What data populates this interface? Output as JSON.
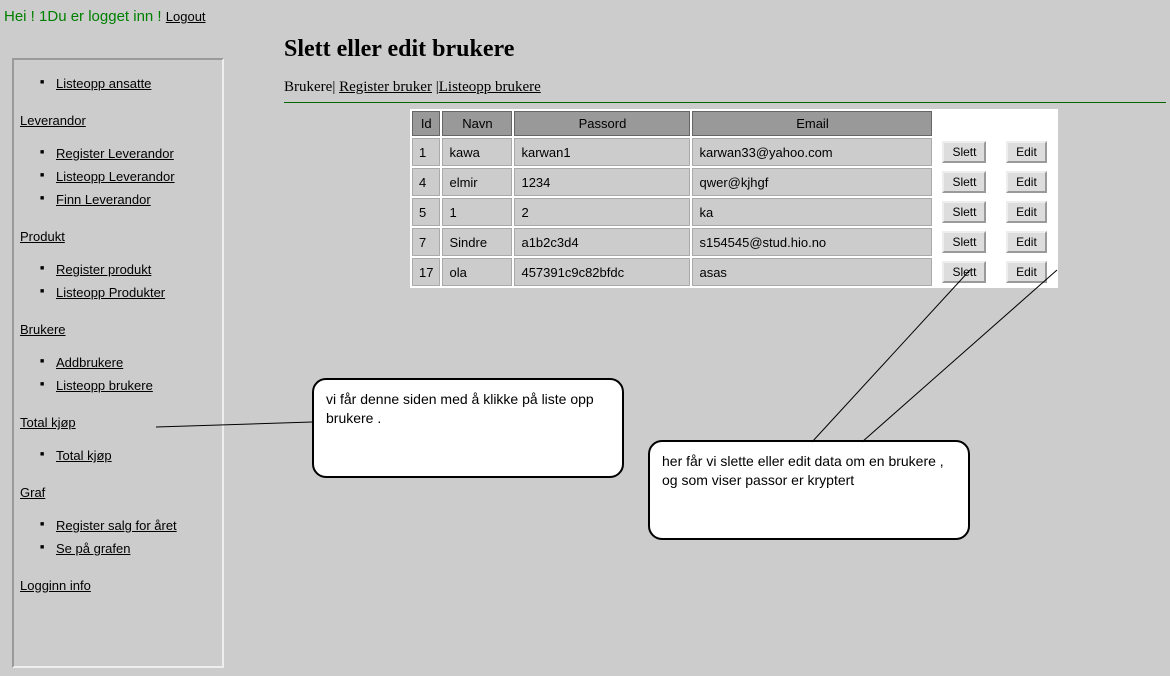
{
  "greeting": {
    "hi": "Hei ! 1",
    "logged_in": "Du er logget inn !",
    "logout": "Logout"
  },
  "sidebar": {
    "first_item": "Listeopp ansatte",
    "groups": [
      {
        "title": "Leverandor",
        "items": [
          "Register Leverandor",
          "Listeopp Leverandor",
          "Finn Leverandor"
        ]
      },
      {
        "title": "Produkt",
        "items": [
          "Register produkt",
          "Listeopp Produkter"
        ]
      },
      {
        "title": "Brukere",
        "items": [
          "Addbrukere",
          "Listeopp brukere"
        ]
      },
      {
        "title": "Total kjøp",
        "items": [
          "Total kjøp"
        ]
      },
      {
        "title": "Graf",
        "items": [
          "Register salg for året",
          "Se på grafen"
        ]
      },
      {
        "title": "Logginn info",
        "items": []
      }
    ]
  },
  "page": {
    "title": "Slett eller edit brukere",
    "sub_bold": "Brukere",
    "sub_link1": "Register bruker",
    "sub_link2": "Listeopp brukere"
  },
  "table": {
    "headers": {
      "id": "Id",
      "navn": "Navn",
      "passord": "Passord",
      "email": "Email"
    },
    "rows": [
      {
        "id": "1",
        "navn": "kawa",
        "passord": "karwan1",
        "email": "karwan33@yahoo.com"
      },
      {
        "id": "4",
        "navn": "elmir",
        "passord": "1234",
        "email": "qwer@kjhgf"
      },
      {
        "id": "5",
        "navn": "1",
        "passord": "2",
        "email": "ka"
      },
      {
        "id": "7",
        "navn": "Sindre",
        "passord": "a1b2c3d4",
        "email": "s154545@stud.hio.no"
      },
      {
        "id": "17",
        "navn": "ola",
        "passord": "457391c9c82bfdc",
        "email": "asas"
      }
    ],
    "btn_slett": "Slett",
    "btn_edit": "Edit"
  },
  "callouts": {
    "c1": "vi får denne siden med å klikke på liste opp brukere .",
    "c2": "her får vi slette eller edit  data om en brukere , og som viser passor er kryptert"
  }
}
